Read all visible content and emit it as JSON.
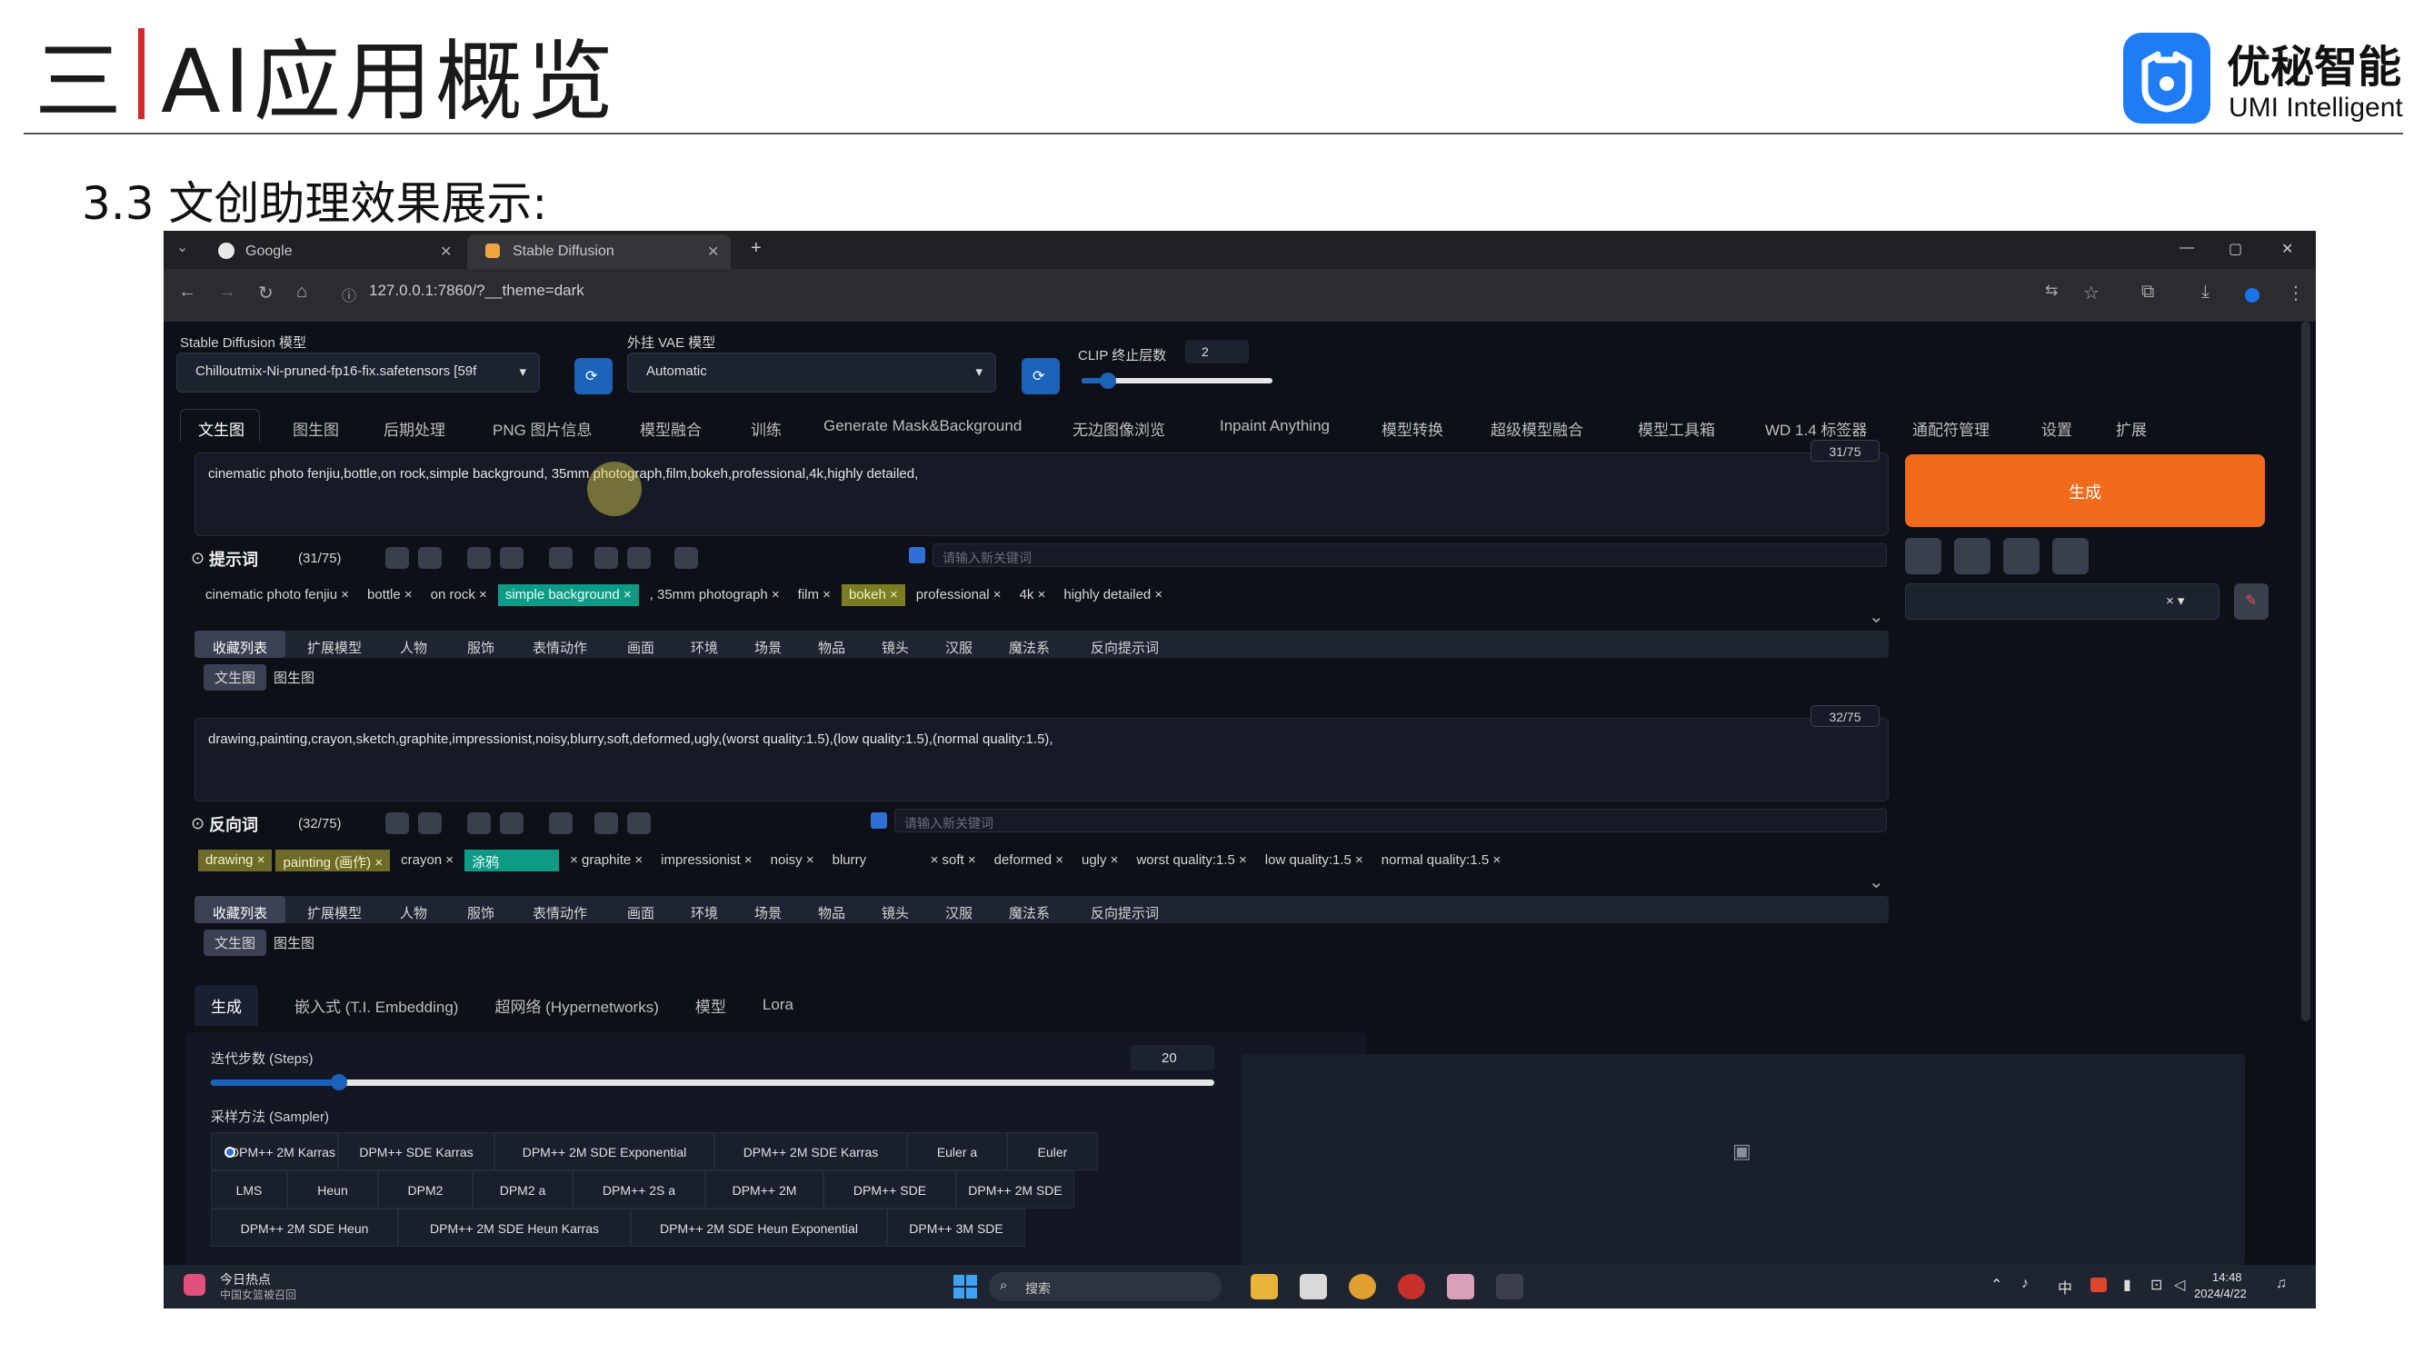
{
  "slide": {
    "title_prefix": "三",
    "title_main": "AI应用概览",
    "section_heading": "3.3 文创助理效果展示:",
    "brand_cn": "优秘智能",
    "brand_en": "UMI Intelligent",
    "colors": {
      "brand_blue": "#1f7cf5",
      "accent_red": "#d9262c"
    }
  },
  "browser": {
    "tabs": [
      {
        "label": "Google",
        "icon": "google-icon"
      },
      {
        "label": "Stable Diffusion",
        "icon": "sd-icon"
      }
    ],
    "new_tab": "+",
    "url": "127.0.0.1:7860/?__theme=dark",
    "window_controls": [
      "—",
      "▢",
      "✕"
    ]
  },
  "webui": {
    "model_label": "Stable Diffusion 模型",
    "model_value": "Chilloutmix-Ni-pruned-fp16-fix.safetensors [59f",
    "vae_label": "外挂 VAE 模型",
    "vae_value": "Automatic",
    "clip_label": "CLIP 终止层数",
    "clip_value": "2",
    "nav_tabs": [
      "文生图",
      "图生图",
      "后期处理",
      "PNG 图片信息",
      "模型融合",
      "训练",
      "Generate Mask&Background",
      "无边图像浏览",
      "Inpaint Anything",
      "模型转换",
      "超级模型融合",
      "模型工具箱",
      "WD 1.4 标签器",
      "通配符管理",
      "设置",
      "扩展"
    ],
    "positive": {
      "text": "cinematic photo fenjiu,bottle,on rock,simple background, 35mm photograph,film,bokeh,professional,4k,highly detailed,",
      "counter": "31/75",
      "title": "提示词",
      "count": "(31/75)",
      "hint": "请输入新关键词",
      "tags": [
        "cinematic photo fenjiu",
        "bottle",
        "on rock",
        "simple background",
        ", 35mm photograph",
        "film",
        "bokeh",
        "professional",
        "4k",
        "highly detailed"
      ]
    },
    "negative": {
      "text": "drawing,painting,crayon,sketch,graphite,impressionist,noisy,blurry,soft,deformed,ugly,(worst quality:1.5),(low quality:1.5),(normal quality:1.5),",
      "counter": "32/75",
      "title": "反向词",
      "count": "(32/75)",
      "hint": "请输入新关键词",
      "tags": [
        "drawing",
        "painting (画作)",
        "crayon",
        "涂鸦",
        "graphite",
        "impressionist",
        "noisy",
        "blurry",
        "soft",
        "deformed",
        "ugly",
        "worst quality:1.5",
        "low quality:1.5",
        "normal quality:1.5"
      ]
    },
    "categories": [
      "收藏列表",
      "扩展模型",
      "人物",
      "服饰",
      "表情动作",
      "画面",
      "环境",
      "场景",
      "物品",
      "镜头",
      "汉服",
      "魔法系",
      "反向提示词"
    ],
    "subtabs": [
      "文生图",
      "图生图"
    ],
    "generate_label": "生成",
    "lower_tabs": [
      "生成",
      "嵌入式 (T.I. Embedding)",
      "超网络 (Hypernetworks)",
      "模型",
      "Lora"
    ],
    "steps_label": "迭代步数 (Steps)",
    "steps_value": "20",
    "steps": {
      "value": 20,
      "min": 1,
      "max": 150
    },
    "sampler_label": "采样方法 (Sampler)",
    "samplers_row1": [
      "DPM++ 2M Karras",
      "DPM++ SDE Karras",
      "DPM++ 2M SDE Exponential",
      "DPM++ 2M SDE Karras",
      "Euler a",
      "Euler"
    ],
    "samplers_row2": [
      "LMS",
      "Heun",
      "DPM2",
      "DPM2 a",
      "DPM++ 2S a",
      "DPM++ 2M",
      "DPM++ SDE",
      "DPM++ 2M SDE"
    ],
    "samplers_row3": [
      "DPM++ 2M SDE Heun",
      "DPM++ 2M SDE Heun Karras",
      "DPM++ 2M SDE Heun Exponential",
      "DPM++ 3M SDE"
    ],
    "colors": {
      "generate": "#f26b1d",
      "accent_blue": "#1c62b8",
      "highlight_teal": "#0d9b86"
    }
  },
  "taskbar": {
    "news_title": "今日热点",
    "news_sub": "中国女篮被召回",
    "search": "搜索",
    "ime": "中",
    "time": "14:48",
    "date": "2024/4/22"
  }
}
